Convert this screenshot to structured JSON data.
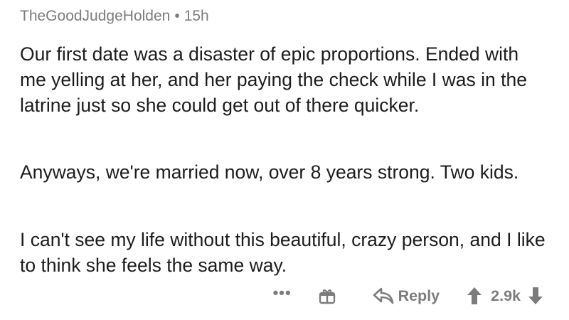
{
  "comment": {
    "author": "TheGoodJudgeHolden",
    "separator": "•",
    "age": "15h",
    "paragraphs": [
      "Our first date was a disaster of epic proportions. Ended with me yelling at her, and her paying the check while I was in the latrine just so she could get out of there quicker.",
      "Anyways, we're married now, over 8 years strong. Two kids.",
      "I can't see my life without this beautiful, crazy person, and I like to think she feels the same way."
    ]
  },
  "actions": {
    "more_label": "•••",
    "reply_label": "Reply",
    "score": "2.9k"
  },
  "icons": {
    "more": "more-options-icon",
    "gift": "gift-icon",
    "reply": "reply-arrow-icon",
    "upvote": "upvote-arrow-icon",
    "downvote": "downvote-arrow-icon"
  },
  "colors": {
    "meta_text": "#7c7c7c",
    "body_text": "#1c1c1c"
  }
}
